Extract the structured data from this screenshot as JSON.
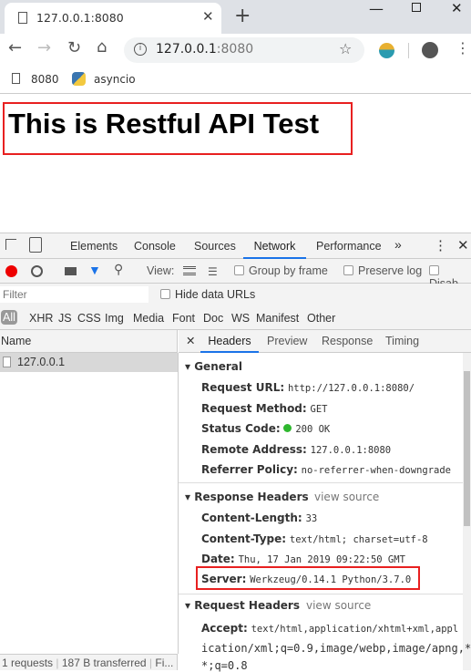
{
  "browser": {
    "tab_title": "127.0.0.1:8080",
    "url_host": "127.0.0.1",
    "url_port": ":8080",
    "bookmarks": [
      {
        "label": "8080",
        "icon": "page-icon"
      },
      {
        "label": "asyncio",
        "icon": "python-icon"
      }
    ]
  },
  "page": {
    "heading": "This is Restful API Test",
    "highlight_color": "#e82020"
  },
  "devtools": {
    "tabs": [
      "Elements",
      "Console",
      "Sources",
      "Network",
      "Performance"
    ],
    "active_tab": "Network",
    "toolbar": {
      "view_label": "View:",
      "group_by_frame": "Group by frame",
      "preserve_log": "Preserve log",
      "disable_cache": "Disab"
    },
    "filter_placeholder": "Filter",
    "hide_data_urls": "Hide data URLs",
    "types": [
      "All",
      "XHR",
      "JS",
      "CSS",
      "Img",
      "Media",
      "Font",
      "Doc",
      "WS",
      "Manifest",
      "Other"
    ],
    "name_header": "Name",
    "requests": [
      "127.0.0.1"
    ],
    "detail_tabs": [
      "Headers",
      "Preview",
      "Response",
      "Timing"
    ],
    "active_detail_tab": "Headers",
    "general": {
      "title": "General",
      "rows": [
        {
          "k": "Request URL:",
          "v": "http://127.0.0.1:8080/"
        },
        {
          "k": "Request Method:",
          "v": "GET"
        },
        {
          "k": "Status Code:",
          "v": "200 OK"
        },
        {
          "k": "Remote Address:",
          "v": "127.0.0.1:8080"
        },
        {
          "k": "Referrer Policy:",
          "v": "no-referrer-when-downgrade"
        }
      ]
    },
    "response_headers": {
      "title": "Response Headers",
      "view_source": "view source",
      "rows": [
        {
          "k": "Content-Length:",
          "v": "33"
        },
        {
          "k": "Content-Type:",
          "v": "text/html; charset=utf-8"
        },
        {
          "k": "Date:",
          "v": "Thu, 17 Jan 2019 09:22:50 GMT"
        },
        {
          "k": "Server:",
          "v": "Werkzeug/0.14.1 Python/3.7.0"
        }
      ]
    },
    "request_headers": {
      "title": "Request Headers",
      "view_source": "view source",
      "accept_key": "Accept:",
      "accept_lines": [
        "text/html,application/xhtml+xml,appl",
        "ication/xml;q=0.9,image/webp,image/apng,*/",
        "*;q=0.8"
      ]
    },
    "status": {
      "requests": "1 requests",
      "transferred": "187 B transferred",
      "finish": "Fi..."
    }
  }
}
